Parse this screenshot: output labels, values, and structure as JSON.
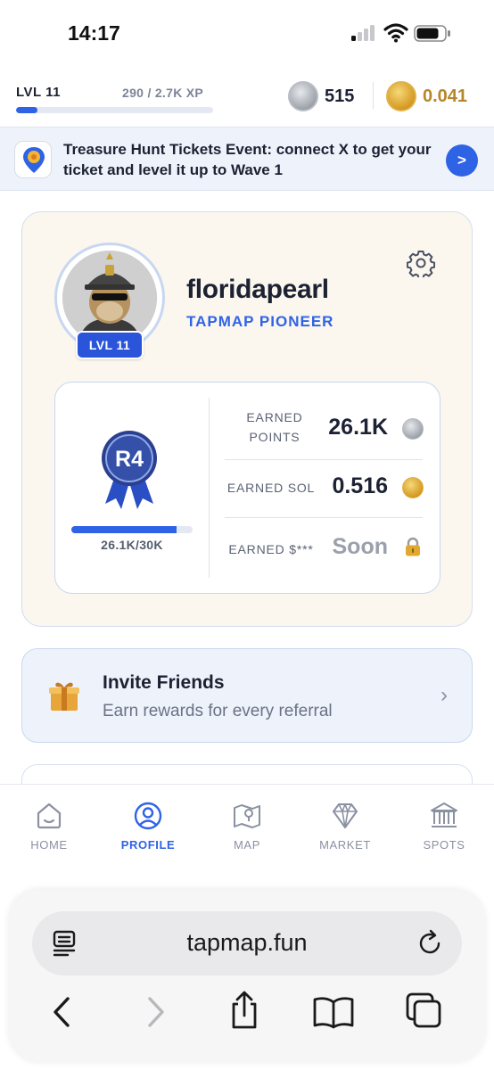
{
  "status_bar": {
    "time": "14:17"
  },
  "header": {
    "level_label": "LVL 11",
    "xp_text": "290 / 2.7K XP",
    "xp_progress": 0.107,
    "points_balance": "515",
    "sol_balance": "0.041"
  },
  "banner": {
    "text": "Treasure Hunt Tickets Event: connect X to get your ticket and level it up to Wave 1",
    "button_label": ">"
  },
  "profile": {
    "username": "floridapearl",
    "title": "TAPMAP PIONEER",
    "level_badge": "LVL 11",
    "rank": "R4",
    "rank_progress": 0.87,
    "rank_progress_text": "26.1K/30K",
    "stats": [
      {
        "label": "EARNED POINTS",
        "value": "26.1K",
        "icon": "silver-coin-icon"
      },
      {
        "label": "EARNED SOL",
        "value": "0.516",
        "icon": "sol-coin-icon"
      },
      {
        "label": "EARNED $***",
        "value": "Soon",
        "icon": "lock-icon"
      }
    ]
  },
  "invite": {
    "title": "Invite Friends",
    "subtitle": "Earn rewards for every referral"
  },
  "nav": {
    "items": [
      {
        "label": "HOME",
        "icon": "home-icon"
      },
      {
        "label": "PROFILE",
        "icon": "profile-icon",
        "active": true
      },
      {
        "label": "MAP",
        "icon": "map-icon"
      },
      {
        "label": "MARKET",
        "icon": "diamond-icon"
      },
      {
        "label": "SPOTS",
        "icon": "bank-icon"
      }
    ]
  },
  "browser": {
    "url": "tapmap.fun"
  },
  "colors": {
    "accent": "#2f63e6",
    "card_bg": "#fbf6ee",
    "sol_text": "#b6862a",
    "muted": "#8a91a1"
  }
}
